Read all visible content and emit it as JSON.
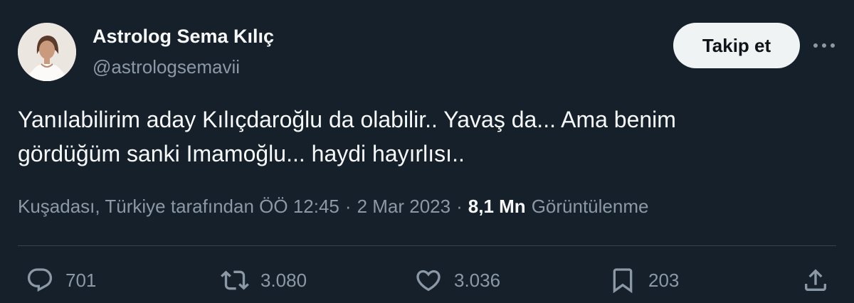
{
  "author": {
    "display_name": "Astrolog Sema Kılıç",
    "handle": "@astrologsemavii"
  },
  "follow_button": {
    "label": "Takip et"
  },
  "more_button": {
    "icon": "more-horizontal-icon"
  },
  "tweet": {
    "text_lines": [
      "Yanılabilirim aday Kılıçdaroğlu da olabilir.. Yavaş da... Ama benim",
      "gördüğüm sanki Imamoğlu... haydi hayırlısı.."
    ]
  },
  "meta": {
    "location_time": "Kuşadası, Türkiye tarafından ÖÖ 12:45",
    "separator": "·",
    "date": "2 Mar 2023",
    "views_count": "8,1 Mn",
    "views_label": "Görüntülenme"
  },
  "actions": {
    "replies": {
      "icon": "reply-icon",
      "count": "701"
    },
    "retweets": {
      "icon": "retweet-icon",
      "count": "3.080"
    },
    "likes": {
      "icon": "heart-icon",
      "count": "3.036"
    },
    "bookmarks": {
      "icon": "bookmark-icon",
      "count": "203"
    },
    "share": {
      "icon": "share-icon"
    }
  },
  "colors": {
    "background": "#15202b",
    "primary_text": "#f7f9f9",
    "secondary_text": "#8b98a5",
    "divider": "#38444d",
    "follow_button_bg": "#eff3f4"
  }
}
